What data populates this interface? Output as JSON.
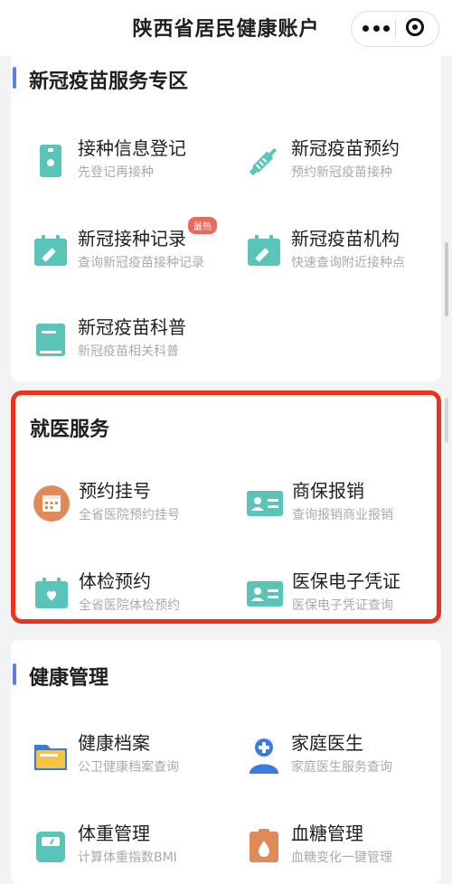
{
  "header": {
    "title": "陕西省居民健康账户"
  },
  "sections": [
    {
      "title": "新冠疫苗服务专区",
      "items": [
        {
          "name": "接种信息登记",
          "sub": "先登记再接种",
          "icon": "id-card-icon"
        },
        {
          "name": "新冠疫苗预约",
          "sub": "预约新冠疫苗接种",
          "icon": "syringe-icon"
        },
        {
          "name": "新冠接种记录",
          "sub": "查询新冠疫苗接种记录",
          "badge": "最热",
          "icon": "vaccine-record-icon"
        },
        {
          "name": "新冠疫苗机构",
          "sub": "快速查询附近接种点",
          "icon": "vaccine-institution-icon"
        },
        {
          "name": "新冠疫苗科普",
          "sub": "新冠疫苗相关科普",
          "icon": "book-icon"
        }
      ]
    },
    {
      "title": "就医服务",
      "items": [
        {
          "name": "预约挂号",
          "sub": "全省医院预约挂号",
          "icon": "calendar-icon"
        },
        {
          "name": "商保报销",
          "sub": "查询报销商业报销",
          "icon": "person-card-icon"
        },
        {
          "name": "体检预约",
          "sub": "全省医院体检预约",
          "icon": "heart-calendar-icon"
        },
        {
          "name": "医保电子凭证",
          "sub": "医保电子凭证查询",
          "icon": "person-card-icon"
        }
      ]
    },
    {
      "title": "健康管理",
      "items": [
        {
          "name": "健康档案",
          "sub": "公卫健康档案查询",
          "icon": "folder-icon"
        },
        {
          "name": "家庭医生",
          "sub": "家庭医生服务查询",
          "icon": "doctor-icon"
        },
        {
          "name": "体重管理",
          "sub": "计算体重指数BMI",
          "icon": "scale-icon"
        },
        {
          "name": "血糖管理",
          "sub": "血糖变化一键管理",
          "icon": "blood-glucose-icon"
        }
      ]
    }
  ],
  "colors": {
    "accent": "#5b7ee8",
    "highlight_border": "#e8341c",
    "teal": "#5bc4b8",
    "orange": "#e08a5a",
    "blue": "#3a7be0"
  }
}
